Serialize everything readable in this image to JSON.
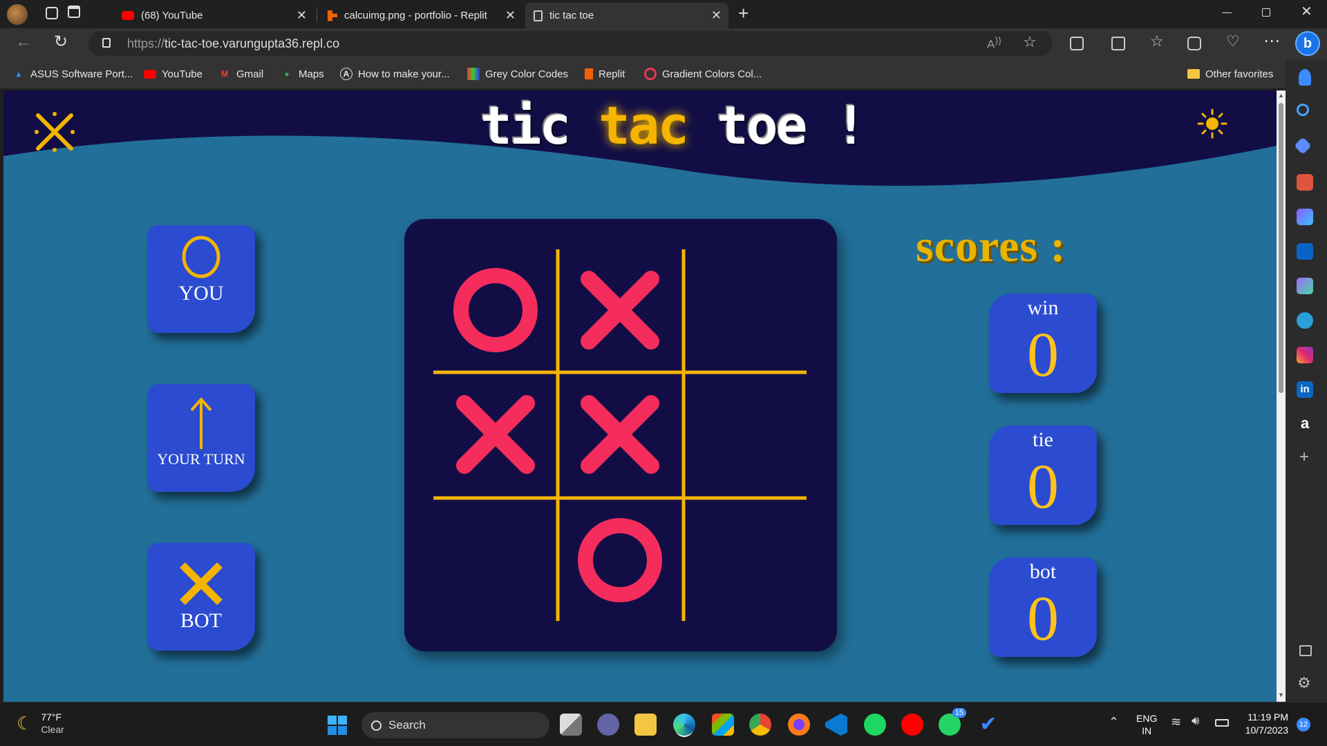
{
  "browser": {
    "tabs": [
      {
        "label": "(68) YouTube"
      },
      {
        "label": "calcuimg.png - portfolio - Replit"
      },
      {
        "label": "tic tac toe"
      }
    ],
    "url_proto": "https://",
    "url_host": "tic-tac-toe.varungupta36.repl.co",
    "favorites": [
      {
        "label": "ASUS Software Port..."
      },
      {
        "label": "YouTube"
      },
      {
        "label": "Gmail"
      },
      {
        "label": "Maps"
      },
      {
        "label": "How to make your..."
      },
      {
        "label": "Grey Color Codes"
      },
      {
        "label": "Replit"
      },
      {
        "label": "Gradient Colors Col..."
      }
    ],
    "other_favorites": "Other favorites"
  },
  "game": {
    "title_part1": "tic",
    "title_part2": "tac",
    "title_part3": "toe !",
    "player_symbol": "O",
    "player_label": "YOU",
    "turn_arrow": "↑",
    "turn_label": "YOUR TURN",
    "bot_symbol": "✕",
    "bot_label": "BOT",
    "board": [
      "O",
      "X",
      "",
      "X",
      "X",
      "",
      "",
      "O",
      ""
    ],
    "scores_title": "scores :",
    "scores": [
      {
        "label": "win",
        "value": "0"
      },
      {
        "label": "tie",
        "value": "0"
      },
      {
        "label": "bot",
        "value": "0"
      }
    ],
    "colors": {
      "accent": "#f4b400",
      "mark": "#f42d5c",
      "tile": "#2b4bd0",
      "board": "#120e45",
      "bg": "#22709a",
      "header": "#120e45"
    }
  },
  "taskbar": {
    "weather_temp": "77°F",
    "weather_cond": "Clear",
    "search_label": "Search",
    "lang1": "ENG",
    "lang2": "IN",
    "time": "11:19 PM",
    "date": "10/7/2023",
    "whatsapp_badge": "15",
    "notif_count": "12"
  }
}
